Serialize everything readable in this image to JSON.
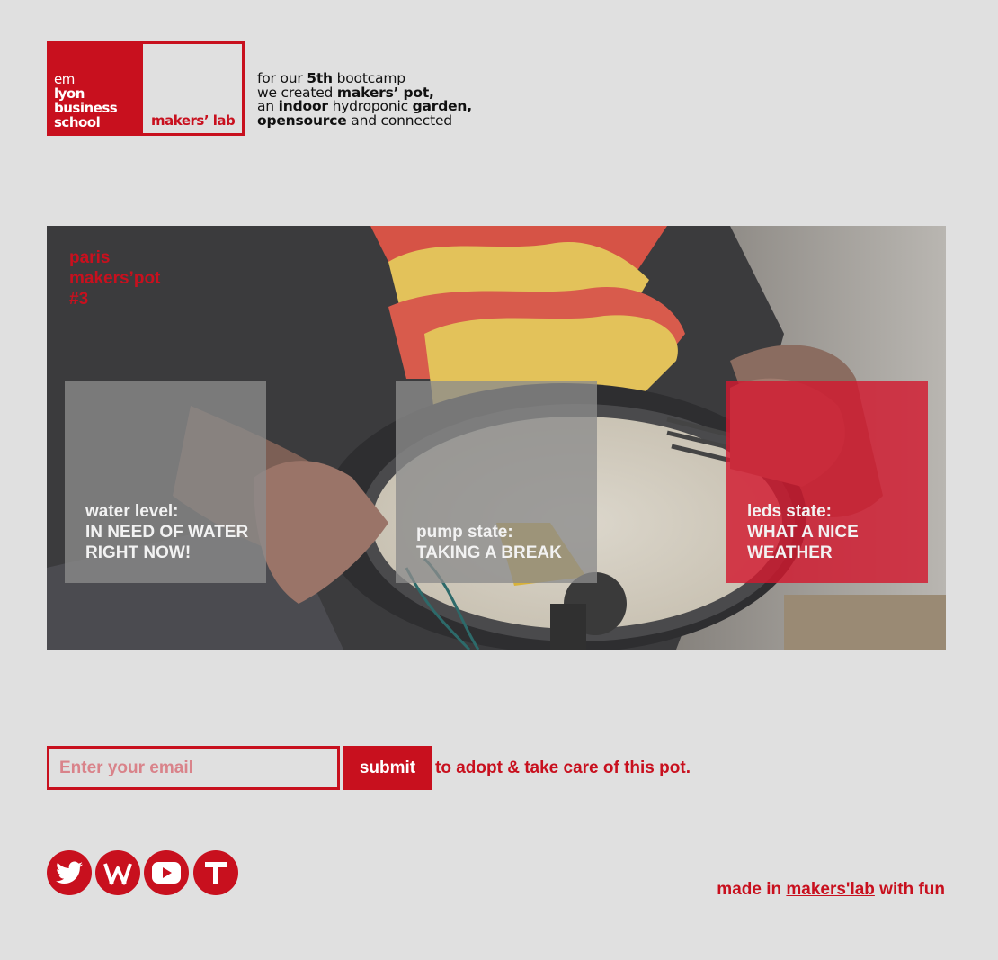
{
  "header": {
    "logo_em_lines": [
      "em",
      "lyon",
      "business",
      "school"
    ],
    "logo_makers_lab": "makers’ lab",
    "tagline": {
      "line1": {
        "a": "for our ",
        "b": "5th",
        "c": " bootcamp"
      },
      "line2": {
        "a": "we created ",
        "b": "makers’ pot,"
      },
      "line3": {
        "a": "an ",
        "b": "indoor",
        "c": " hydroponic ",
        "d": "garden,"
      },
      "line4": {
        "a": "opensource",
        "b": " and connected"
      }
    }
  },
  "hero": {
    "title_lines": [
      "paris",
      "makers’pot",
      "#3"
    ],
    "panels": [
      {
        "label": "water level:",
        "value_lines": [
          "IN NEED OF WATER",
          "RIGHT NOW!"
        ],
        "style": "gray"
      },
      {
        "label": "pump state:",
        "value_lines": [
          "TAKING A BREAK"
        ],
        "style": "gray"
      },
      {
        "label": "leds state:",
        "value_lines": [
          "WHAT A NICE",
          "WEATHER"
        ],
        "style": "red"
      }
    ]
  },
  "form": {
    "email_placeholder": "Enter your email",
    "submit_label": "submit",
    "adopt_text": "to adopt & take care of this pot."
  },
  "social": [
    {
      "icon": "twitter-icon"
    },
    {
      "icon": "wordpress-icon"
    },
    {
      "icon": "youtube-icon"
    },
    {
      "icon": "tumblr-icon"
    }
  ],
  "footer": {
    "prefix": "made in ",
    "link": "makers'lab",
    "suffix": " with fun"
  },
  "colors": {
    "brand_red": "#c8101e",
    "background": "#e0e0e0"
  }
}
